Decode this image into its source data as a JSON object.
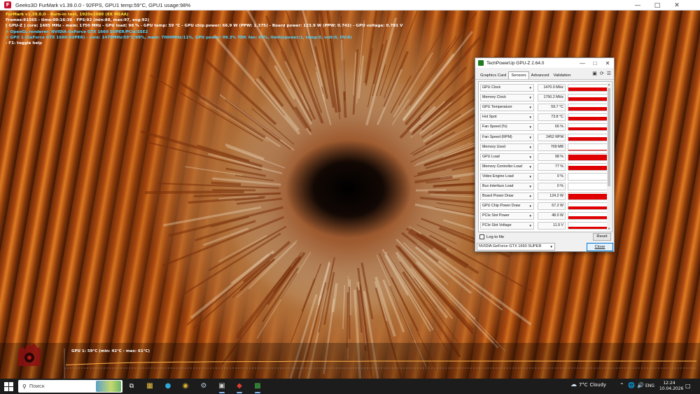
{
  "furmark": {
    "window_title": "Geeks3D FurMark v1.39.0.0 - 92FPS, GPU1 temp:59°C, GPU1 usage:98%",
    "osd": [
      {
        "text": "FurMark v1.39.0.0 - Burn-in test, 1920x1080 (8X MSAA)",
        "color": "yellow"
      },
      {
        "text": "Frames:91565 - time:00:16:38 - FPS:92 (min:88, max:97, avg:92)",
        "color": "white"
      },
      {
        "text": "[ GPU-Z ] core: 1485 MHz - mem: 1750 MHz - GPU load: 98 % - GPU temp: 59 °C - GPU chip power: 66.9 W (PPW: 1.375) - Board power: 123.9 W (PPW: 0.742) - GPU voltage: 0.781 V",
        "color": "white"
      },
      {
        "text": "> OpenGL renderer: NVIDIA GeForce GTX 1660 SUPER/PCIe/SSE2",
        "color": "cyan"
      },
      {
        "text": "> GPU 1 (GeForce GTX 1660 SUPER) - core: 1470MHz/59°C/98%, mem: 7000MHz/11%, GPU power: 99.3% TDP, fan: 66%, limits(power:1, temp:0, volt:0, OV:0)",
        "color": "cyan"
      },
      {
        "text": "- F1: toggle help",
        "color": "white"
      }
    ],
    "graph_label": "GPU 1: 59°C (min: 42°C - max: 61°C)",
    "graph_series": [
      42,
      45,
      48,
      50,
      52,
      53,
      54,
      55,
      55,
      56,
      56,
      57,
      57,
      57,
      58,
      58,
      58,
      58,
      58,
      59,
      59,
      59,
      59,
      59,
      59,
      59,
      59,
      59,
      59,
      59,
      59,
      59,
      59,
      59,
      59,
      59,
      59,
      59,
      59,
      59
    ],
    "graph_range": [
      0,
      100
    ]
  },
  "gpuz": {
    "window_title": "TechPowerUp GPU-Z 2.64.0",
    "tabs": [
      "Graphics Card",
      "Sensors",
      "Advanced",
      "Validation"
    ],
    "active_tab": "Sensors",
    "sensors": [
      {
        "name": "GPU Clock",
        "value": "1470.0 MHz",
        "level": 0.55
      },
      {
        "name": "Memory Clock",
        "value": "1750.2 MHz",
        "level": 0.6
      },
      {
        "name": "GPU Temperature",
        "value": "59.7 °C",
        "level": 0.55
      },
      {
        "name": "Hot Spot",
        "value": "73.8 °C",
        "level": 0.6
      },
      {
        "name": "Fan Speed (%)",
        "value": "66 %",
        "level": 0.5
      },
      {
        "name": "Fan Speed (RPM)",
        "value": "2452 RPM",
        "level": 0.5
      },
      {
        "name": "Memory Used",
        "value": "709 MB",
        "level": 0.1
      },
      {
        "name": "GPU Load",
        "value": "98 %",
        "level": 0.9
      },
      {
        "name": "Memory Controller Load",
        "value": "77 %",
        "level": 0.6
      },
      {
        "name": "Video Engine Load",
        "value": "0 %",
        "level": 0
      },
      {
        "name": "Bus Interface Load",
        "value": "0 %",
        "level": 0
      },
      {
        "name": "Board Power Draw",
        "value": "124.2 W",
        "level": 0.85
      },
      {
        "name": "GPU Chip Power Draw",
        "value": "67.2 W",
        "level": 0.5
      },
      {
        "name": "PCIe Slot Power",
        "value": "48.0 W",
        "level": 0.45
      },
      {
        "name": "PCIe Slot Voltage",
        "value": "11.9 V",
        "level": 0.4
      }
    ],
    "log_label": "Log to file",
    "reset_label": "Reset",
    "gpu_selected": "NVIDIA GeForce GTX 1660 SUPER",
    "close_label": "Close"
  },
  "taskbar": {
    "search_placeholder": "Поиск",
    "weather_temp": "7°C",
    "weather_text": "Cloudy",
    "lang": "ENG",
    "time": "12:24",
    "date": "10.04.2026",
    "accent": "#7fb6f0"
  }
}
